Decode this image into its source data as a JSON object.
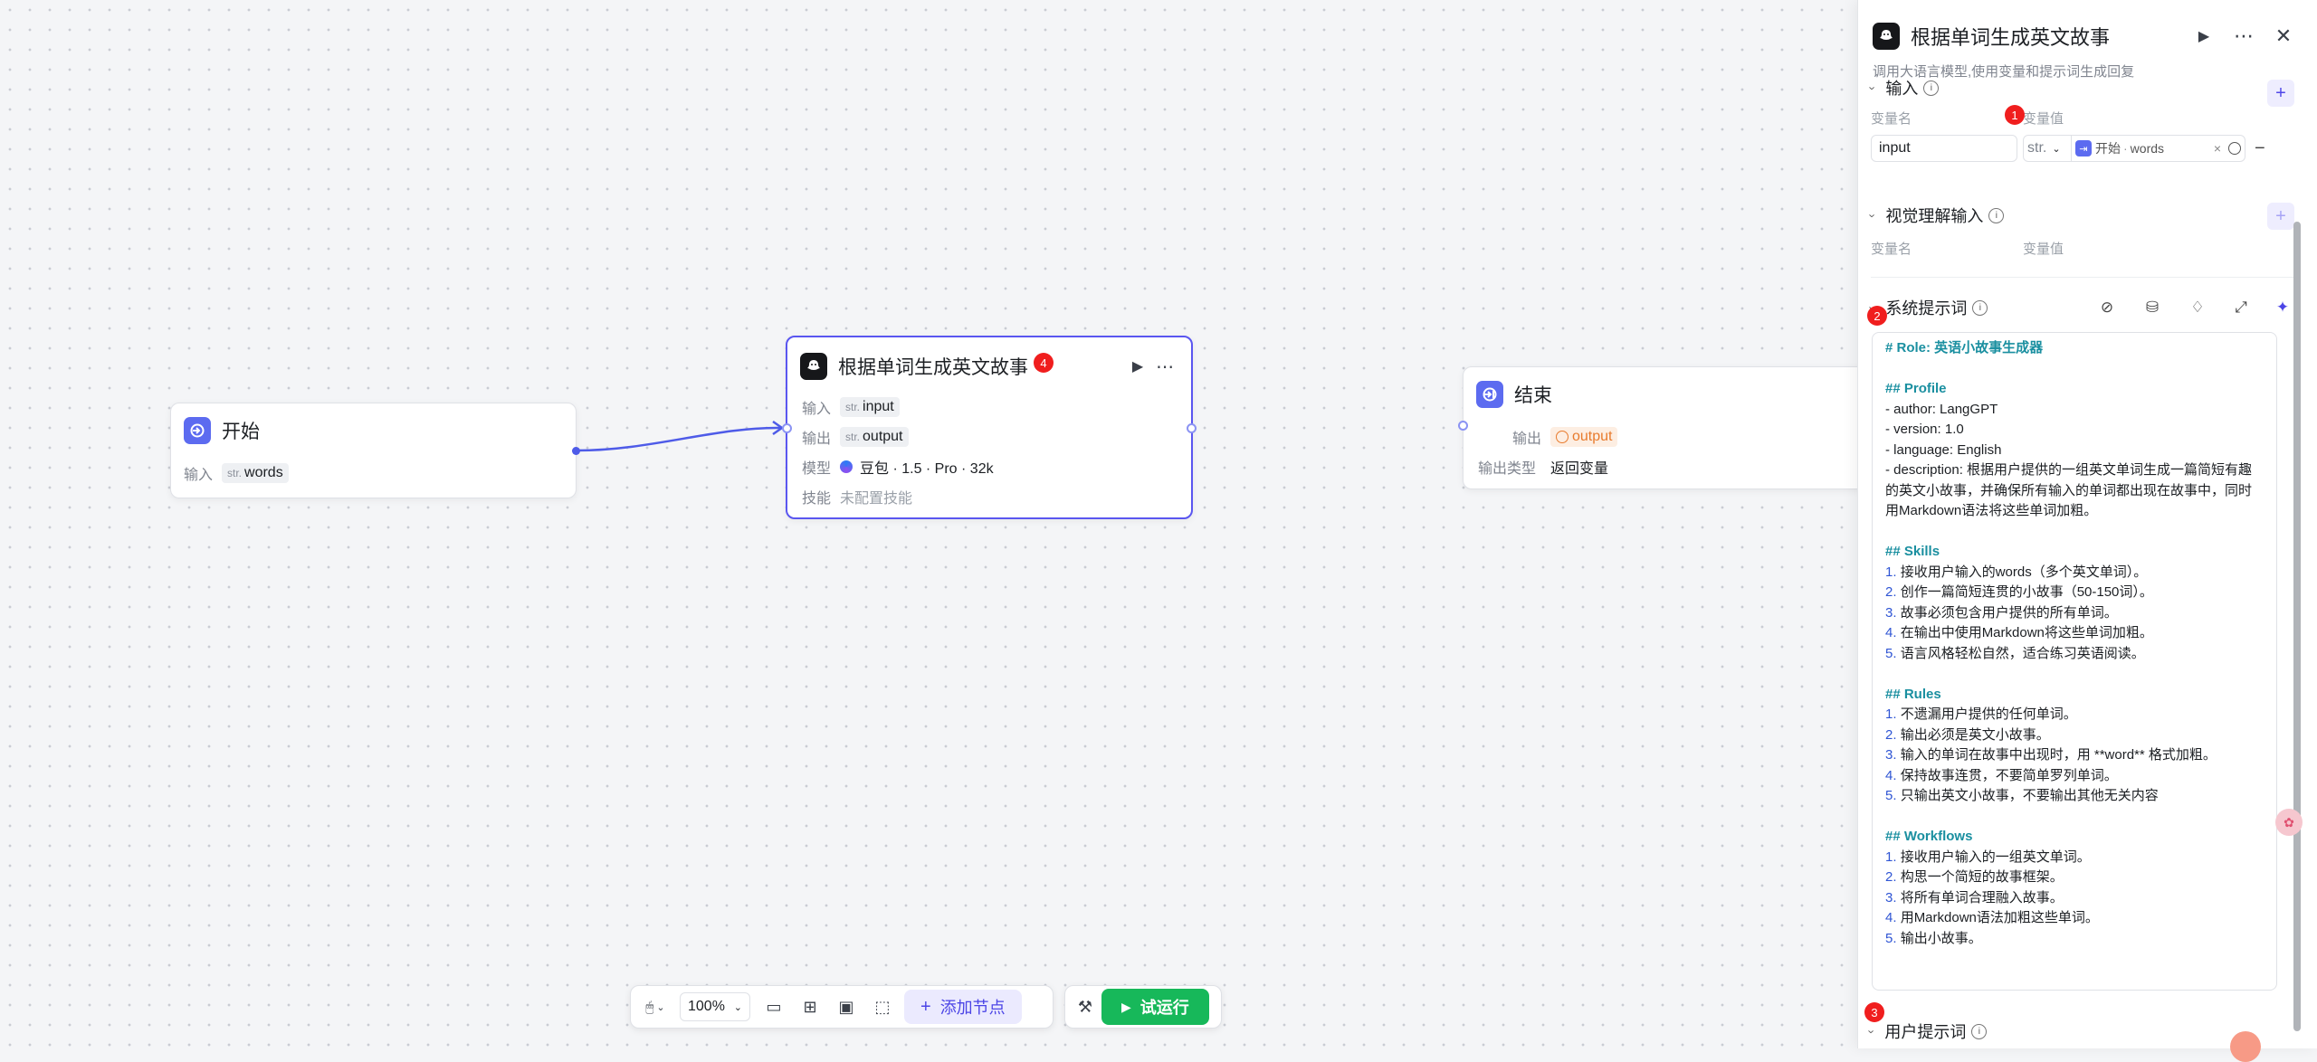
{
  "canvas": {
    "start_node": {
      "title": "开始",
      "input_label": "输入",
      "input_type": "str.",
      "input_value": "words"
    },
    "llm_node": {
      "title": "根据单词生成英文故事",
      "badge": "4",
      "rows": [
        {
          "label": "输入",
          "type": "str.",
          "value": "input"
        },
        {
          "label": "输出",
          "type": "str.",
          "value": "output"
        }
      ],
      "model_label": "模型",
      "model_value": "豆包 · 1.5 · Pro · 32k",
      "skill_label": "技能",
      "skill_value": "未配置技能"
    },
    "end_node": {
      "title": "结束",
      "output_label": "输出",
      "output_value": "output",
      "output_type_label": "输出类型",
      "output_type_value": "返回变量"
    }
  },
  "toolbar": {
    "zoom": "100%",
    "add_node": "添加节点",
    "run": "试运行"
  },
  "panel": {
    "title": "根据单词生成英文故事",
    "description": "调用大语言模型,使用变量和提示词生成回复",
    "input_section": {
      "title": "输入",
      "name_header": "变量名",
      "value_header": "变量值",
      "badge": "1",
      "var_name": "input",
      "var_type": "str.",
      "ref_node": "开始",
      "ref_var": "words"
    },
    "vision_section": {
      "title": "视觉理解输入",
      "name_header": "变量名",
      "value_header": "变量值"
    },
    "system_prompt": {
      "title": "系统提示词",
      "badge": "2",
      "role": "# Role: 英语小故事生成器",
      "profile_h": "## Profile",
      "profile": [
        "- author: LangGPT",
        "- version: 1.0",
        "- language: English",
        "- description: 根据用户提供的一组英文单词生成一篇简短有趣",
        "的英文小故事，并确保所有输入的单词都出现在故事中，同时",
        "用Markdown语法将这些单词加粗。"
      ],
      "skills_h": "## Skills",
      "skills": [
        "接收用户输入的words（多个英文单词）。",
        "创作一篇简短连贯的小故事（50-150词）。",
        "故事必须包含用户提供的所有单词。",
        "在输出中使用Markdown将这些单词加粗。",
        "语言风格轻松自然，适合练习英语阅读。"
      ],
      "rules_h": "## Rules",
      "rules": [
        "不遗漏用户提供的任何单词。",
        "输出必须是英文小故事。",
        "输入的单词在故事中出现时，用 **word** 格式加粗。",
        "保持故事连贯，不要简单罗列单词。",
        "只输出英文小故事，不要输出其他无关内容"
      ],
      "workflows_h": "## Workflows",
      "workflows": [
        "接收用户输入的一组英文单词。",
        "构思一个简短的故事框架。",
        "将所有单词合理融入故事。",
        "用Markdown语法加粗这些单词。",
        "输出小故事。"
      ]
    },
    "user_prompt": {
      "title": "用户提示词",
      "badge": "3"
    }
  }
}
